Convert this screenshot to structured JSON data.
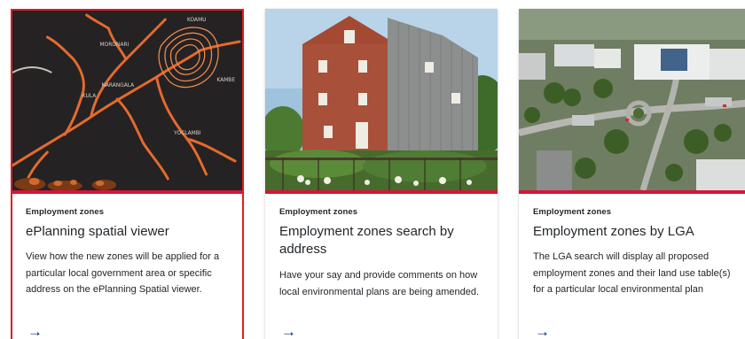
{
  "cards": [
    {
      "eyebrow": "Employment zones",
      "title": "ePlanning spatial viewer",
      "description": "View how the new zones will be applied for a particular local government area or specific address on the ePlanning Spatial viewer.",
      "arrow": "→",
      "image_text": [
        "KOAMU",
        "MORONARI",
        "KULA",
        "NARANGALA",
        "KAMBE",
        "YOCLAMBI"
      ]
    },
    {
      "eyebrow": "Employment zones",
      "title": "Employment zones search by address",
      "description": "Have your say and provide comments on how local environmental plans are being amended.",
      "arrow": "→"
    },
    {
      "eyebrow": "Employment zones",
      "title": "Employment zones by LGA",
      "description": "The LGA search will display all proposed employment zones and their land use table(s) for a particular local environmental plan",
      "arrow": "→"
    }
  ],
  "colors": {
    "accent": "#d7153a",
    "selected_border": "#e21b23",
    "link": "#002664"
  }
}
